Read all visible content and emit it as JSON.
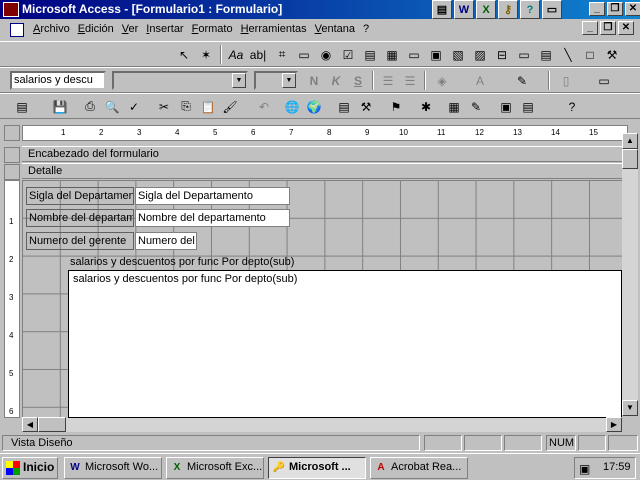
{
  "window": {
    "title": "Microsoft Access - [Formulario1 : Formulario]",
    "tray_icons": [
      "notepad-icon",
      "word-icon",
      "excel-icon",
      "key-icon",
      "question-icon",
      "monitor-icon"
    ],
    "buttons": {
      "minimize": "_",
      "restore": "❐",
      "close": "✕"
    }
  },
  "menubar": {
    "items": [
      "Archivo",
      "Edición",
      "Ver",
      "Insertar",
      "Formato",
      "Herramientas",
      "Ventana",
      "?"
    ]
  },
  "format_toolbar": {
    "object_combo": "salarios y descu",
    "font_combo": "",
    "size_combo": "",
    "bold": "N",
    "italic": "K",
    "underline": "S"
  },
  "design": {
    "ruler_numbers": [
      "1",
      "2",
      "3",
      "4",
      "5",
      "6",
      "7",
      "8",
      "9",
      "10",
      "11",
      "12",
      "13",
      "14",
      "15"
    ],
    "left_ruler_numbers": [
      "1",
      "2",
      "3",
      "4",
      "5",
      "6"
    ],
    "header_section": "Encabezado del formulario",
    "detail_section": "Detalle",
    "fields": [
      {
        "label": "Sigla del Departamen",
        "value": "Sigla del Departamento"
      },
      {
        "label": "Nombre del departam",
        "value": "Nombre del departamento"
      },
      {
        "label": "Numero del gerente",
        "value": "Numero del"
      }
    ],
    "subform": {
      "header": "salarios y descuentos por func  Por depto(sub)",
      "body": "salarios y descuentos por func  Por depto(sub)"
    }
  },
  "statusbar": {
    "text": "Vista Diseño",
    "num": "NUM"
  },
  "taskbar": {
    "start": "Inicio",
    "tasks": [
      {
        "label": "Microsoft Wo...",
        "icon": "W"
      },
      {
        "label": "Microsoft Exc...",
        "icon": "X"
      },
      {
        "label": "Microsoft ...",
        "icon": "🔑"
      },
      {
        "label": "Acrobat Rea...",
        "icon": "A"
      }
    ],
    "clock": "17:59"
  }
}
